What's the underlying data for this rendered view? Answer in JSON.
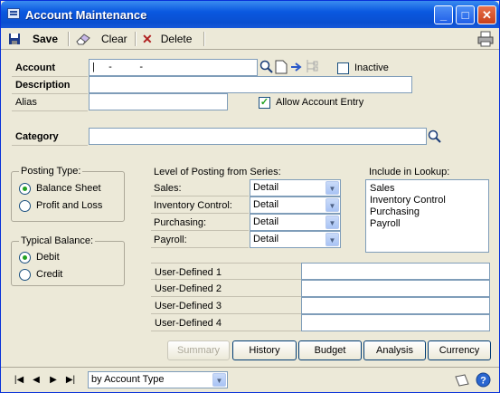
{
  "window": {
    "title": "Account Maintenance",
    "minimize": "_",
    "maximize": "□",
    "close": "✕"
  },
  "toolbar": {
    "save": "Save",
    "clear": "Clear",
    "delete": "Delete"
  },
  "account": {
    "account_label": "Account",
    "account_value": "|     -          -",
    "description_label": "Description",
    "alias_label": "Alias",
    "inactive_label": "Inactive",
    "allow_entry_label": "Allow Account Entry",
    "allow_entry_checked": true,
    "category_label": "Category"
  },
  "posting_type": {
    "title": "Posting Type:",
    "options": [
      "Balance Sheet",
      "Profit and Loss"
    ],
    "selected": 0
  },
  "typical_balance": {
    "title": "Typical Balance:",
    "options": [
      "Debit",
      "Credit"
    ],
    "selected": 0
  },
  "posting_level": {
    "title": "Level of Posting from Series:",
    "rows": [
      {
        "label": "Sales:",
        "value": "Detail"
      },
      {
        "label": "Inventory Control:",
        "value": "Detail"
      },
      {
        "label": "Purchasing:",
        "value": "Detail"
      },
      {
        "label": "Payroll:",
        "value": "Detail"
      }
    ]
  },
  "lookup": {
    "title": "Include in Lookup:",
    "items": [
      "Sales",
      "Inventory Control",
      "Purchasing",
      "Payroll"
    ]
  },
  "user_defined": [
    "User-Defined 1",
    "User-Defined 2",
    "User-Defined 3",
    "User-Defined 4"
  ],
  "buttons": {
    "summary": "Summary",
    "history": "History",
    "budget": "Budget",
    "analysis": "Analysis",
    "currency": "Currency"
  },
  "status": {
    "sort": "by Account Type"
  }
}
